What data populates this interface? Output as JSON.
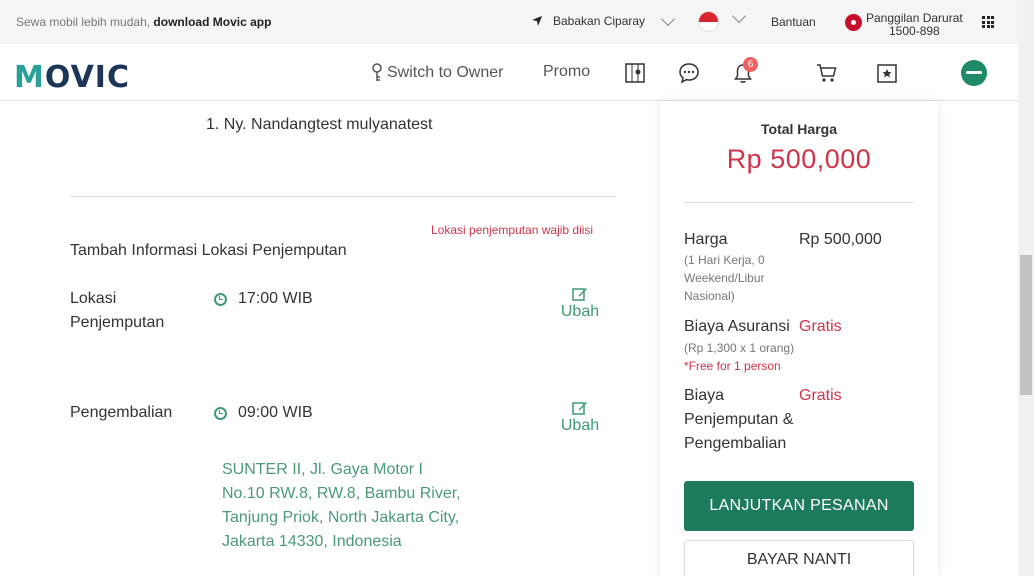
{
  "topbar": {
    "promo_text": "Sewa mobil lebih mudah, ",
    "promo_link": "download Movic app",
    "location": "Babakan Ciparay",
    "help": "Bantuan",
    "emergency_label": "Panggilan Darurat",
    "emergency_number": "1500-898"
  },
  "nav": {
    "logo_a": "M",
    "logo_b": "O",
    "logo_c": "VIC",
    "switch_owner": "Switch to Owner",
    "promo": "Promo",
    "notification_count": "6"
  },
  "main": {
    "passenger": "1. Ny. Nandangtest mulyanatest",
    "pickup_warning": "Lokasi penjemputan wajib diisi",
    "add_info_title": "Tambah Informasi Lokasi Penjemputan",
    "pickup_label_1": "Lokasi",
    "pickup_label_2": "Penjemputan",
    "pickup_time": "17:00 WIB",
    "return_label": "Pengembalian",
    "return_time": "09:00 WIB",
    "edit_label": "Ubah",
    "return_address": "SUNTER II, Jl. Gaya Motor I No.10 RW.8, RW.8, Bambu River, Tanjung Priok, North Jakarta City, Jakarta 14330, Indonesia"
  },
  "summary": {
    "total_label": "Total Harga",
    "total_value": "Rp 500,000",
    "price_label": "Harga",
    "price_value": "Rp 500,000",
    "price_note_1": "(1 Hari Kerja, 0",
    "price_note_2": "Weekend/Libur",
    "price_note_3": "Nasional)",
    "insurance_label": "Biaya Asuransi",
    "insurance_value": "Gratis",
    "insurance_note": "(Rp 1,300 x 1 orang)",
    "insurance_free": "*Free for 1 person",
    "pickup_fee_label_1": "Biaya",
    "pickup_fee_label_2": "Penjemputan &",
    "pickup_fee_label_3": "Pengembalian",
    "pickup_fee_value": "Gratis",
    "continue_button": "LANJUTKAN PESANAN",
    "pay_later_button": "BAYAR NANTI"
  },
  "colors": {
    "brand_green": "#1e7a5f",
    "accent_red": "#d0344a",
    "link_green": "#3d9a72"
  }
}
